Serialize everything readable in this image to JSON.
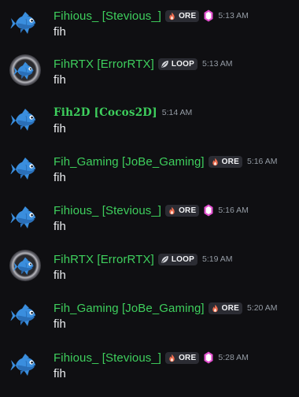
{
  "messages": [
    {
      "avatar": "blue-fish-icon",
      "username": "Fihious_ [Stevious_]",
      "tag": {
        "icon": "flame-icon",
        "label": "ORE"
      },
      "badge": "pink-gem-icon",
      "time": "5:13 AM",
      "text": "fih"
    },
    {
      "avatar": "blue-fish-icon",
      "username": "FihRTX [ErrorRTX]",
      "tag": {
        "icon": "leaf-icon",
        "label": "LOOP"
      },
      "time": "5:13 AM",
      "text": "fih"
    },
    {
      "avatar": "blue-fish-icon",
      "username": "Fih2D [Cocos2D]",
      "time": "5:14 AM",
      "text": "fih"
    },
    {
      "avatar": "blue-fish-icon",
      "username": "Fih_Gaming [JoBe_Gaming]",
      "tag": {
        "icon": "flame-icon",
        "label": "ORE"
      },
      "time": "5:16 AM",
      "text": "fih"
    },
    {
      "avatar": "blue-fish-icon",
      "username": "Fihious_ [Stevious_]",
      "tag": {
        "icon": "flame-icon",
        "label": "ORE"
      },
      "badge": "pink-gem-icon",
      "time": "5:16 AM",
      "text": "fih"
    },
    {
      "avatar": "blue-fish-icon",
      "username": "FihRTX [ErrorRTX]",
      "tag": {
        "icon": "leaf-icon",
        "label": "LOOP"
      },
      "time": "5:19 AM",
      "text": "fih"
    },
    {
      "avatar": "blue-fish-icon",
      "username": "Fih_Gaming [JoBe_Gaming]",
      "tag": {
        "icon": "flame-icon",
        "label": "ORE"
      },
      "time": "5:20 AM",
      "text": "fih"
    },
    {
      "avatar": "blue-fish-icon",
      "username": "Fihious_ [Stevious_]",
      "tag": {
        "icon": "flame-icon",
        "label": "ORE"
      },
      "badge": "pink-gem-icon",
      "time": "5:28 AM",
      "text": "fih"
    }
  ],
  "colors": {
    "background": "#0f0f12",
    "username": "#3ecf5d",
    "tag_background": "#2b2c33",
    "timestamp": "#949ba4",
    "message_text": "#eceef1"
  }
}
